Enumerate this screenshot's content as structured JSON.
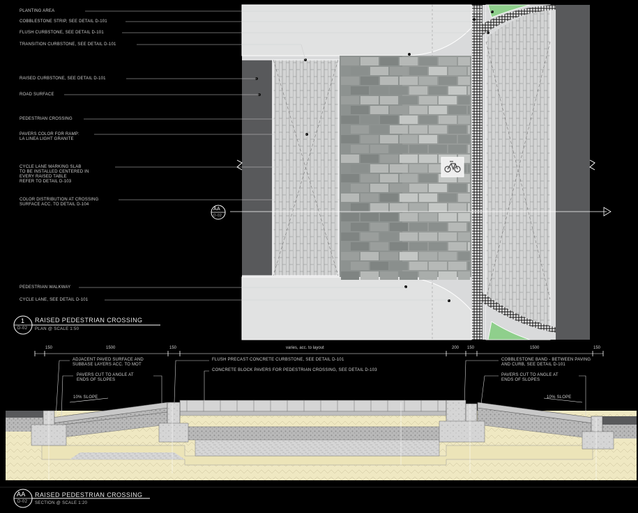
{
  "plan": {
    "labels": [
      "PLANTING AREA",
      "COBBLESTONE STRIP, SEE DETAIL D-101",
      "FLUSH CURBSTONE, SEE DETAIL D-101",
      "TRANSITION CURBSTONE, SEE DETAIL D-101",
      "RAISED CURBSTONE, SEE DETAIL D-101",
      "ROAD SURFACE",
      "PEDESTRIAN CROSSING",
      "PAVERS COLOR FOR RAMP:\nLA LINEA LIGHT GRANITE",
      "CYCLE LANE MARKING SLAB\nTO BE INSTALLED CENTERED IN\nEVERY RAISED TABLE\nREFER TO DETAIL D-103",
      "COLOR DISTRIBUTION AT CROSSING\nSURFACE ACC. TO DETAIL D-104",
      "PEDESTRIAN WALKWAY",
      "CYCLE LANE, SEE DETAIL D-101"
    ],
    "section_marker": {
      "code": "AA",
      "sheet": "D-02"
    },
    "title": {
      "number": "1",
      "sheet": "D-02",
      "name": "RAISED PEDESTRIAN CROSSING",
      "scale": "PLAN @ SCALE 1:50"
    },
    "bike_icon": "bicycle-icon"
  },
  "section": {
    "dimensions": [
      "150",
      "1500",
      "150",
      "varies, acc. to layout",
      "200",
      "150",
      "1500",
      "150"
    ],
    "labels": [
      "ADJACENT PAVED SURFACE AND\nSUBBASE LAYERS ACC. TO MOT",
      "PAVERS CUT TO ANGLE AT\nENDS OF SLOPES",
      "FLUSH PRECAST CONCRETE CURBSTONE, SEE DETAIL D-101",
      "CONCRETE BLOCK PAVERS FOR PEDESTRIAN CROSSING, SEE DETAIL D-103",
      "COBBLESTONE BAND - BETWEEN PAVING\nAND CURB, SEE DETAIL D-101",
      "PAVERS CUT TO ANGLE AT\nENDS OF SLOPES"
    ],
    "slopes": [
      "10% SLOPE",
      "10% SLOPE"
    ],
    "title": {
      "code": "AA",
      "sheet": "D-02",
      "name": "RAISED PEDESTRIAN CROSSING",
      "scale": "SECTION @ SCALE 1:20"
    }
  },
  "colors": {
    "background": "#000000",
    "road": "#58595b",
    "light_pavement": "#d9dadb",
    "crossing_dark": "#8d9290",
    "crossing_light": "#b9bcba",
    "planting": "#8fcf8c",
    "subbase": "#f2ecc6",
    "line": "#ffffff"
  }
}
